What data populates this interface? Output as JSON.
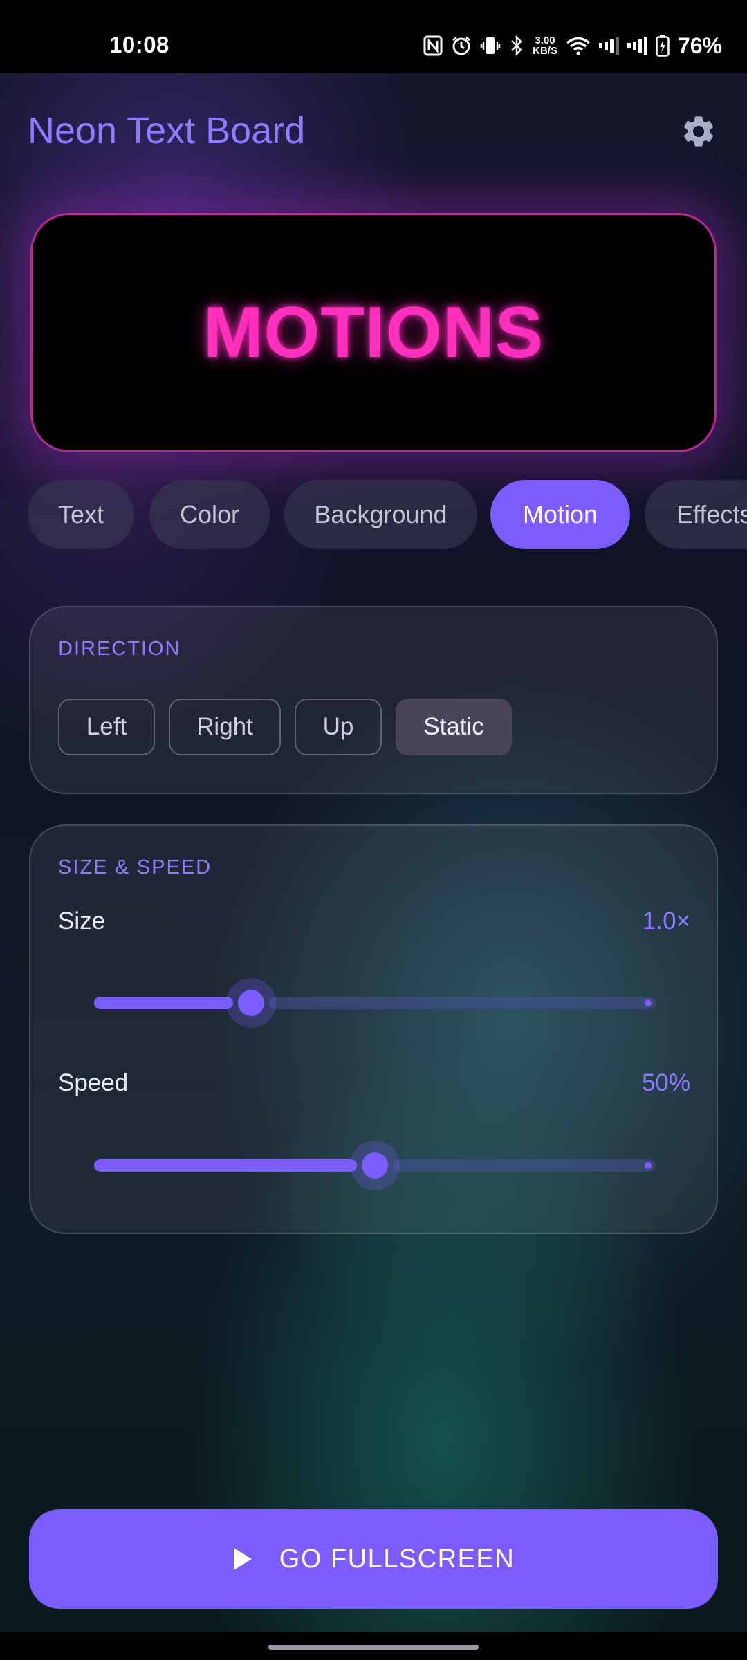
{
  "status_bar": {
    "time": "10:08",
    "speed_value": "3.00",
    "speed_unit": "KB/S",
    "battery": "76%"
  },
  "header": {
    "title": "Neon Text Board",
    "settings_icon": "gear-icon"
  },
  "preview": {
    "text": "MOTIONS",
    "text_color": "#ff2fbe",
    "border_color": "#b52b93"
  },
  "tabs": [
    {
      "label": "Text",
      "active": false
    },
    {
      "label": "Color",
      "active": false
    },
    {
      "label": "Background",
      "active": false
    },
    {
      "label": "Motion",
      "active": true
    },
    {
      "label": "Effects",
      "active": false
    }
  ],
  "direction": {
    "label": "DIRECTION",
    "options": [
      {
        "label": "Left",
        "selected": false
      },
      {
        "label": "Right",
        "selected": false
      },
      {
        "label": "Up",
        "selected": false
      },
      {
        "label": "Static",
        "selected": true
      }
    ]
  },
  "size_speed": {
    "label": "SIZE & SPEED",
    "size": {
      "label": "Size",
      "value_text": "1.0×",
      "fraction": 0.28
    },
    "speed": {
      "label": "Speed",
      "value_text": "50%",
      "fraction": 0.5
    }
  },
  "fullscreen": {
    "label": "GO FULLSCREEN",
    "icon": "play-icon"
  },
  "colors": {
    "accent": "#7b5cff",
    "accent_text": "#8f7bff"
  }
}
